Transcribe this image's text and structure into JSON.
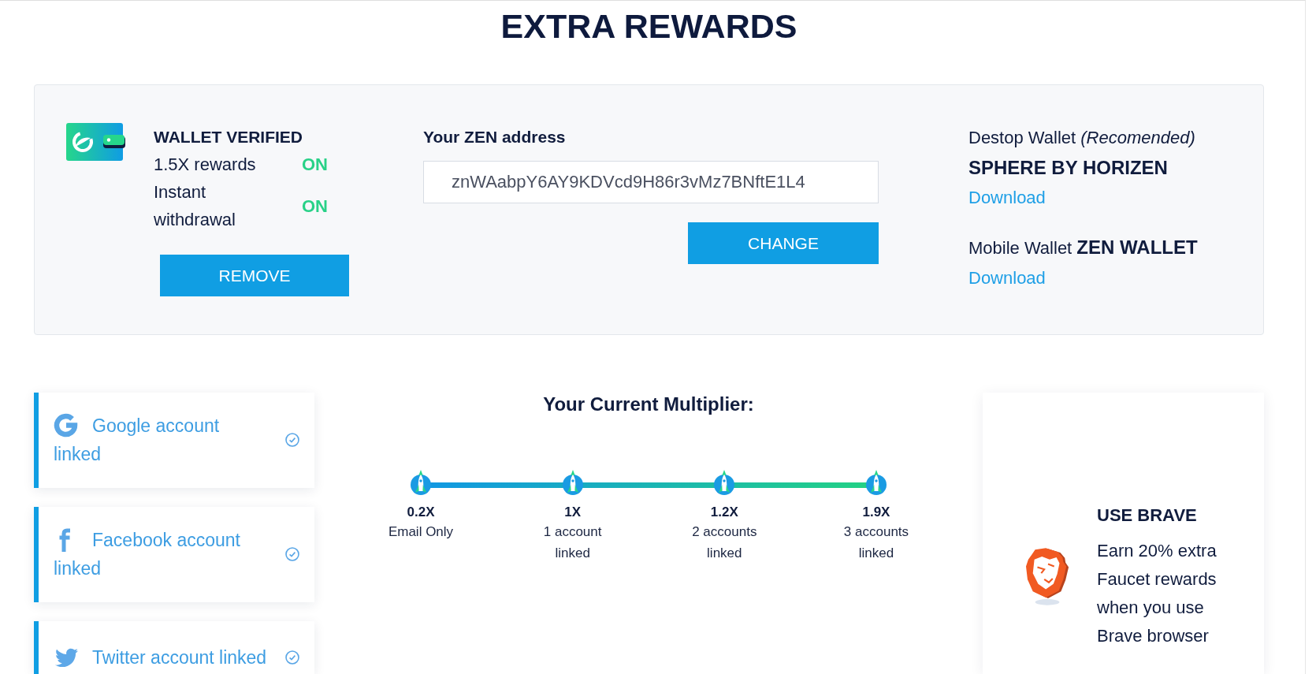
{
  "page": {
    "title": "EXTRA REWARDS"
  },
  "wallet": {
    "title": "WALLET VERIFIED",
    "features": [
      {
        "label": "1.5X rewards",
        "state": "ON",
        "on": true
      },
      {
        "label": "Instant withdrawal",
        "state": "ON",
        "on": true
      }
    ],
    "remove_button": "REMOVE",
    "address_label": "Your ZEN address",
    "address_value": "znWAabpY6AY9KDVcd9H86r3vMz7BNftE1L4",
    "change_button": "CHANGE",
    "downloads": [
      {
        "heading": "Destop Wallet *(Recomended)*",
        "name": "SPHERE BY HORIZEN",
        "link": "Download"
      },
      {
        "heading": "Mobile Wallet **ZEN WALLET**",
        "link": "Download"
      }
    ]
  },
  "accounts": [
    {
      "kind": "google",
      "text": "Google account linked",
      "linked": true
    },
    {
      "kind": "facebook",
      "text": "Facebook account linked",
      "linked": true
    },
    {
      "kind": "twitter",
      "text": "Twitter account linked",
      "linked": true
    }
  ],
  "multiplier": {
    "title": "Your Current Multiplier:",
    "steps": [
      {
        "value": "0.2X",
        "label": "Email Only"
      },
      {
        "value": "1X",
        "label": "1 account linked"
      },
      {
        "value": "1.2X",
        "label": "2 accounts linked"
      },
      {
        "value": "1.9X",
        "label": "3 accounts linked"
      }
    ]
  },
  "brave": {
    "title": "USE BRAVE",
    "text": "Earn 20% extra Faucet rewards when you use Brave browser"
  }
}
